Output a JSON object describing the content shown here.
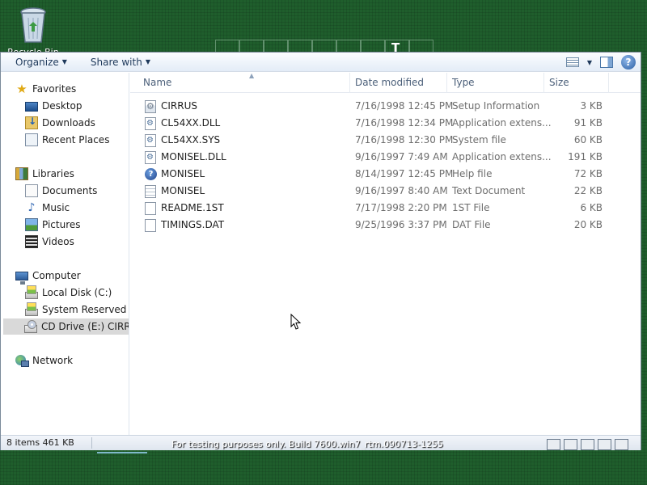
{
  "desktop": {
    "recycle_bin_label": "Recycle Bin"
  },
  "toolbar": {
    "organize_label": "Organize",
    "share_label": "Share with",
    "help_label": "?"
  },
  "nav": {
    "favorites": "Favorites",
    "desktop": "Desktop",
    "downloads": "Downloads",
    "recent_places": "Recent Places",
    "libraries": "Libraries",
    "documents": "Documents",
    "music": "Music",
    "pictures": "Pictures",
    "videos": "Videos",
    "computer": "Computer",
    "local_disk": "Local Disk (C:)",
    "system_reserved": "System Reserved (D:",
    "cd_drive": "CD Drive (E:) CIRRUS",
    "network": "Network"
  },
  "columns": {
    "name": "Name",
    "date_modified": "Date modified",
    "type": "Type",
    "size": "Size"
  },
  "files": [
    {
      "name": "CIRRUS",
      "date": "7/16/1998 12:45 PM",
      "type": "Setup Information",
      "size": "3 KB",
      "icon": "setup-file-icon"
    },
    {
      "name": "CL54XX.DLL",
      "date": "7/16/1998 12:34 PM",
      "type": "Application extens...",
      "size": "91 KB",
      "icon": "dll-file-icon"
    },
    {
      "name": "CL54XX.SYS",
      "date": "7/16/1998 12:30 PM",
      "type": "System file",
      "size": "60 KB",
      "icon": "system-file-icon"
    },
    {
      "name": "MONISEL.DLL",
      "date": "9/16/1997 7:49 AM",
      "type": "Application extens...",
      "size": "191 KB",
      "icon": "dll-file-icon"
    },
    {
      "name": "MONISEL",
      "date": "8/14/1997 12:45 PM",
      "type": "Help file",
      "size": "72 KB",
      "icon": "help-file-icon"
    },
    {
      "name": "MONISEL",
      "date": "9/16/1997 8:40 AM",
      "type": "Text Document",
      "size": "22 KB",
      "icon": "text-file-icon"
    },
    {
      "name": "README.1ST",
      "date": "7/17/1998 2:20 PM",
      "type": "1ST File",
      "size": "6 KB",
      "icon": "generic-file-icon"
    },
    {
      "name": "TIMINGS.DAT",
      "date": "9/25/1996 3:37 PM",
      "type": "DAT File",
      "size": "20 KB",
      "icon": "generic-file-icon"
    }
  ],
  "status": {
    "text": "8 items 461 KB"
  },
  "taskbar": {
    "text": "For testing purposes only. Build 7600.win7_rtm.090713-1255"
  }
}
